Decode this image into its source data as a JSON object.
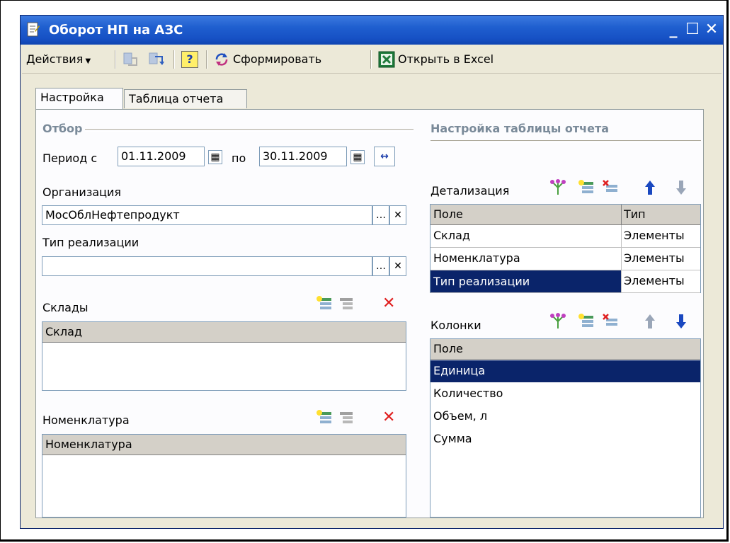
{
  "window": {
    "title": "Оборот НП на АЗС"
  },
  "toolbar": {
    "actions": "Действия",
    "form": "Сформировать",
    "excel": "Открыть в Excel"
  },
  "tabs": [
    {
      "label": "Настройка"
    },
    {
      "label": "Таблица отчета"
    }
  ],
  "filter": {
    "title": "Отбор",
    "period_from_label": "Период с",
    "date_from": "01.11.2009",
    "period_to_label": "по",
    "date_to": "30.11.2009",
    "org_label": "Организация",
    "org_value": "МосОблНефтепродукт",
    "sale_type_label": "Тип реализации",
    "sale_type_value": "",
    "warehouses_label": "Склады",
    "warehouses_col": "Склад",
    "nomenclature_label": "Номенклатура",
    "nomenclature_col": "Номенклатура"
  },
  "report_settings": {
    "title": "Настройка таблицы отчета",
    "detail_label": "Детализация",
    "detail_cols": {
      "field": "Поле",
      "type": "Тип"
    },
    "detail_rows": [
      {
        "field": "Склад",
        "type": "Элементы"
      },
      {
        "field": "Номенклатура",
        "type": "Элементы"
      },
      {
        "field": "Тип реализации",
        "type": "Элементы"
      }
    ],
    "columns_label": "Колонки",
    "columns_col": "Поле",
    "columns_rows": [
      "Единица",
      "Количество",
      "Объем, л",
      "Сумма"
    ]
  },
  "colors": {
    "title_bar": "#1f5fcf",
    "selection": "#0a246a",
    "section_title": "#7a8a99"
  }
}
